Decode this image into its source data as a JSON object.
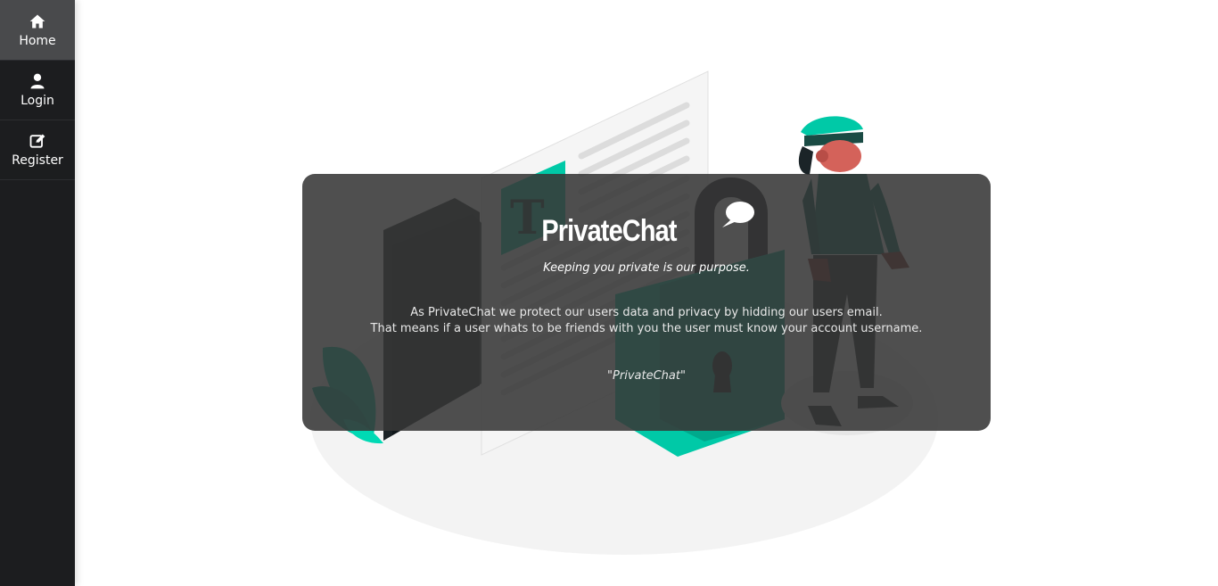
{
  "sidebar": {
    "items": [
      {
        "label": "Home",
        "icon": "home-icon",
        "active": true
      },
      {
        "label": "Login",
        "icon": "user-icon",
        "active": false
      },
      {
        "label": "Register",
        "icon": "edit-icon",
        "active": false
      }
    ]
  },
  "hero": {
    "title": "PrivateChat",
    "tagline": "Keeping you private is our purpose.",
    "description_line1": "As PrivateChat we protect our users data and privacy by hidding our users email.",
    "description_line2": "That means if a user whats to be friends with you the user must know your account username.",
    "quote": "\"PrivateChat\""
  },
  "colors": {
    "sidebar_bg": "#1c1d1f",
    "active_item_bg": "#494a4c",
    "card_bg": "rgba(55,55,55,0.88)",
    "accent_teal": "#00c9a7"
  }
}
